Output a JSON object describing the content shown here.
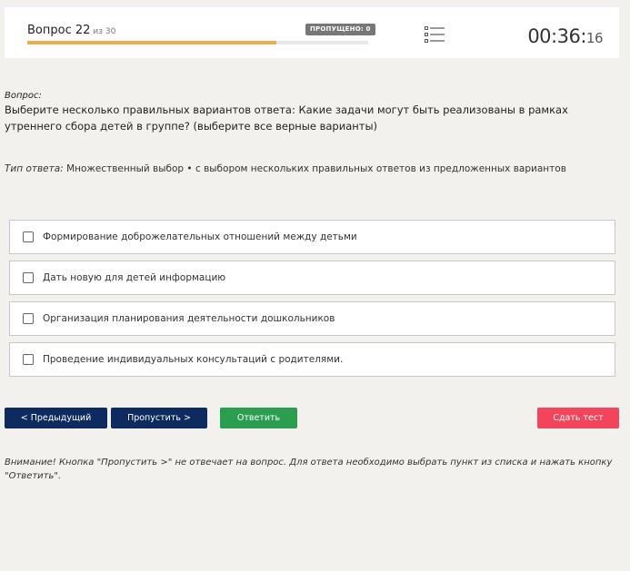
{
  "header": {
    "question_label": "Вопрос 22",
    "of_label": "из 30",
    "skipped_badge": "ПРОПУЩЕНО: 0",
    "progress": 0.73,
    "timer_main": "00:36:",
    "timer_seconds": "16"
  },
  "question": {
    "label": "Вопрос:",
    "text": "Выберите несколько правильных вариантов ответа: Какие задачи могут быть реализованы в рамках утреннего сбора детей в группе? (выберите все верные варианты)"
  },
  "answer_type": {
    "label": "Тип ответа:",
    "value": "Множественный выбор • с выбором нескольких правильных ответов из предложенных вариантов"
  },
  "options": [
    {
      "label": "Формирование доброжелательных отношений между детьми",
      "checked": false
    },
    {
      "label": "Дать новую для детей информацию",
      "checked": false
    },
    {
      "label": "Организация планирования деятельности дошкольников",
      "checked": false
    },
    {
      "label": "Проведение индивидуальных консультаций с родителями.",
      "checked": false
    }
  ],
  "buttons": {
    "prev": "< Предыдущий",
    "skip": "Пропустить >",
    "answer": "Ответить",
    "submit": "Сдать тест"
  },
  "note": "Внимание! Кнопка \"Пропустить >\" не отвечает на вопрос. Для ответа необходимо выбрать пункт из списка и нажать кнопку \"Ответить\".",
  "colors": {
    "progress": "#f0ad4e",
    "primary": "#0d2b5e",
    "success": "#2a9d4f",
    "danger": "#f2445a"
  }
}
